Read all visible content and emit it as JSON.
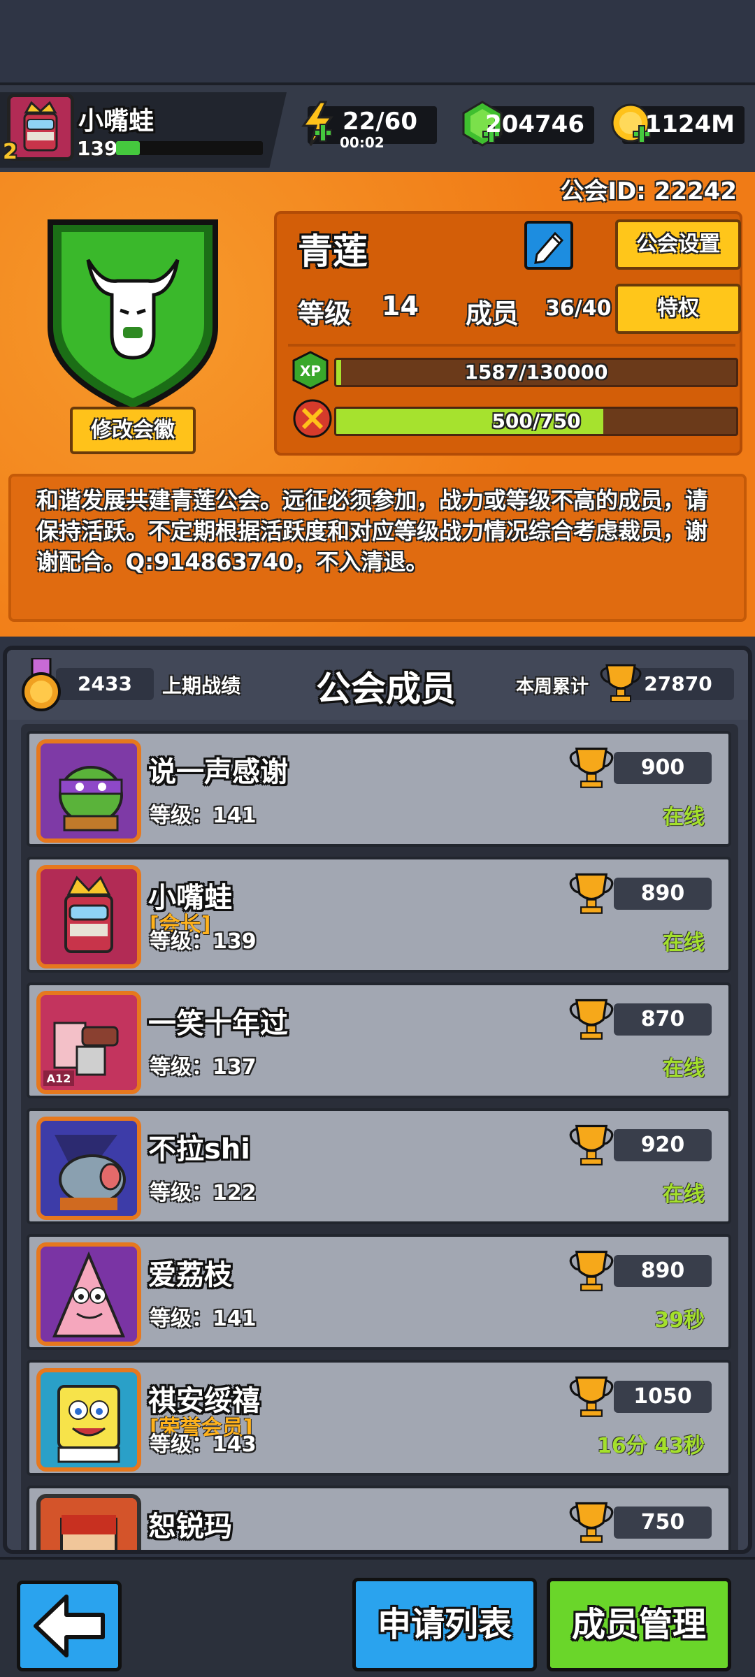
{
  "player": {
    "name": "小嘴蛙",
    "level": "139",
    "rank": "2"
  },
  "resources": {
    "energy": "22/60",
    "energy_timer": "00:02",
    "gems": "204746",
    "coins": "1124M"
  },
  "guild": {
    "id_text": "公会ID: 22242",
    "name": "青莲",
    "edit_emblem_label": "修改会徽",
    "settings_label": "公会设置",
    "privilege_label": "特权",
    "level_label": "等级",
    "level_value": "14",
    "members_label": "成员",
    "members_value": "36/40",
    "xp_badge": "XP",
    "xp_text": "1587/130000",
    "xp_progress": 0.012,
    "war_text": "500/750",
    "war_progress": 0.667,
    "description": "和谐发展共建青莲公会。远征必须参加，战力或等级不高的成员，请保持活跃。不定期根据活跃度和对应等级战力情况综合考虑裁员，谢谢配合。Q:914863740，不入清退。"
  },
  "members_panel": {
    "title": "公会成员",
    "last_war_value": "2433",
    "last_war_label": "上期战绩",
    "week_label": "本周累计",
    "week_value": "27870"
  },
  "members": [
    {
      "name": "说一声感谢",
      "role": "",
      "level": "等级：141",
      "points": "900",
      "status": "在线"
    },
    {
      "name": "小嘴蛙",
      "role": "[会长]",
      "level": "等级：139",
      "points": "890",
      "status": "在线"
    },
    {
      "name": "一笑十年过",
      "role": "",
      "level": "等级：137",
      "points": "870",
      "status": "在线"
    },
    {
      "name": "不拉shi",
      "role": "",
      "level": "等级：122",
      "points": "920",
      "status": "在线"
    },
    {
      "name": "爱荔枝",
      "role": "",
      "level": "等级：141",
      "points": "890",
      "status": "39秒"
    },
    {
      "name": "祺安绥禧",
      "role": "[荣誉会员]",
      "level": "等级：143",
      "points": "1050",
      "status": "16分 43秒"
    },
    {
      "name": "恕锐玛",
      "role": "",
      "level": "",
      "points": "750",
      "status": ""
    }
  ],
  "avatar_badges": {
    "member3": "A12"
  },
  "bottom": {
    "apply_label": "申请列表",
    "manage_label": "成员管理"
  },
  "colors": {
    "guild_orange": "#f07b16",
    "online_green": "#a4e02c",
    "button_yellow": "#ffc61a",
    "button_blue": "#2aa3ee",
    "button_green": "#6ad62a"
  }
}
